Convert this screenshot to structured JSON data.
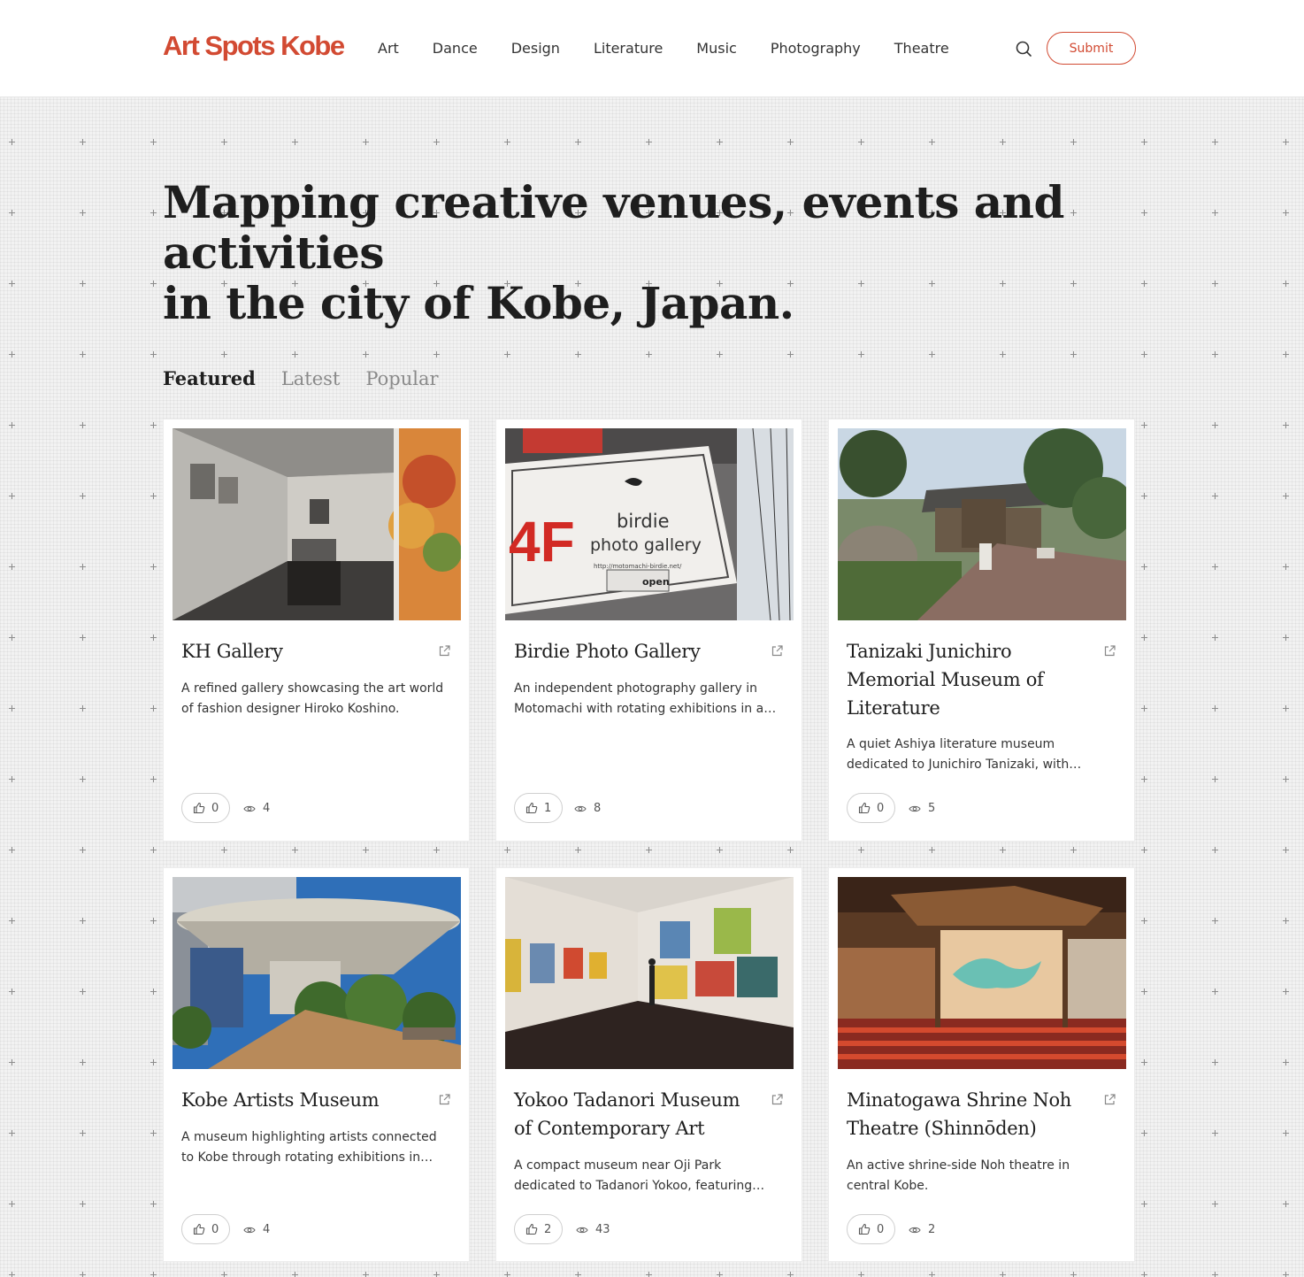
{
  "site": {
    "logo": "Art Spots Kobe",
    "submit_label": "Submit",
    "accent_color": "#d24a32"
  },
  "nav": [
    "Art",
    "Dance",
    "Design",
    "Literature",
    "Music",
    "Photography",
    "Theatre"
  ],
  "hero": {
    "line1": "Mapping creative venues, events and activities",
    "line2": "in the city of Kobe, Japan."
  },
  "tabs": [
    {
      "label": "Featured",
      "active": true
    },
    {
      "label": "Latest",
      "active": false
    },
    {
      "label": "Popular",
      "active": false
    }
  ],
  "cards": [
    {
      "title": "KH Gallery",
      "description": "A refined gallery showcasing the art world of fashion designer Hiroko Koshino.",
      "likes": "0",
      "views": "4"
    },
    {
      "title": "Birdie Photo Gallery",
      "description": "An independent photography gallery in Motomachi with rotating exhibitions in a…",
      "likes": "1",
      "views": "8",
      "sign": {
        "floor": "4F",
        "name_line1": "birdie",
        "name_line2": "photo gallery",
        "url": "http://motomachi-birdie.net/",
        "status": "open"
      }
    },
    {
      "title": "Tanizaki Junichiro Memorial Museum of Literature",
      "description": "A quiet Ashiya literature museum dedicated to Junichiro Tanizaki, with…",
      "likes": "0",
      "views": "5"
    },
    {
      "title": "Kobe Artists Museum",
      "description": "A museum highlighting artists connected to Kobe through rotating exhibitions in an…",
      "likes": "0",
      "views": "4"
    },
    {
      "title": "Yokoo Tadanori Museum of Contemporary Art",
      "description": "A compact museum near Oji Park dedicated to Tadanori Yokoo, featuring…",
      "likes": "2",
      "views": "43"
    },
    {
      "title": "Minatogawa Shrine Noh Theatre (Shinnōden)",
      "description": "An active shrine-side Noh theatre in central Kobe.",
      "likes": "0",
      "views": "2"
    }
  ]
}
